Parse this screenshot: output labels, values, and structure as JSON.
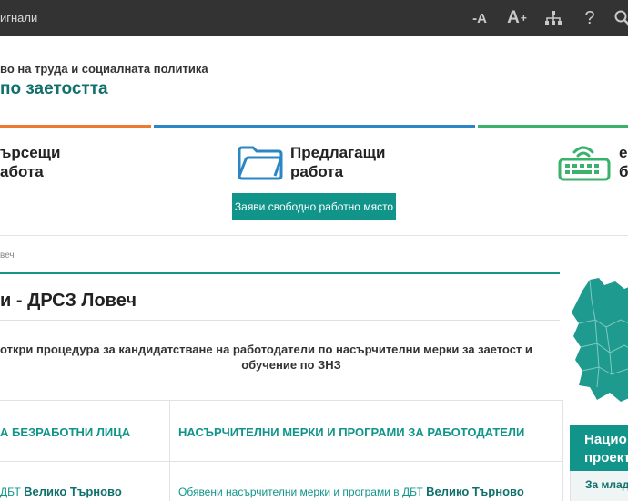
{
  "topbar": {
    "signals_label": "игнали",
    "font_decrease_label": "-A",
    "font_increase_label": "A",
    "font_increase_sup": "+",
    "help_label": "?"
  },
  "header": {
    "ministry": "во на труда и социалната политика",
    "agency": "по заетостта"
  },
  "nav": {
    "seekers_line1": "ърсещи",
    "seekers_line2": "абота",
    "offers_line1": "Предлагащи",
    "offers_line2": "работа",
    "e_line1": "е",
    "e_line2": "б",
    "declare_button": "Заяви свободно работно място"
  },
  "breadcrumb": "веч",
  "page_title": "и - ДРСЗ Ловеч",
  "news": {
    "line1": "откри процедура за кандидатстване на  работодатели по насърчителни мерки за заетост и",
    "line2": "обучение по ЗНЗ"
  },
  "table": {
    "left_header": "А БЕЗРАБОТНИ ЛИЦА",
    "right_header": "НАСЪРЧИТЕЛНИ МЕРКИ И ПРОГРАМИ ЗА РАБОТОДАТЕЛИ",
    "left_link_prefix": "ДБТ ",
    "left_link_place": "Велико Търново",
    "right_link_prefix": "Обявени насърчителни мерки и програми в ДБТ ",
    "right_link_place": "Велико Търново"
  },
  "sidebar": {
    "national_line1": "Нацио",
    "national_line2": "проект",
    "youth_link": "За млад"
  },
  "colors": {
    "topbar_bg": "#333333",
    "accent_teal": "#11958a",
    "agency_teal": "#11706b",
    "stripe_orange": "#ec7b30",
    "stripe_blue": "#2b86c5",
    "stripe_green": "#3bb26b",
    "map_fill": "#1f9a8e"
  }
}
